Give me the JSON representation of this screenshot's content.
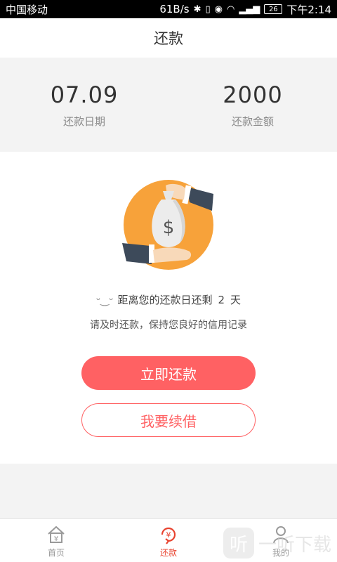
{
  "status_bar": {
    "carrier": "中国移动",
    "speed": "61B/s",
    "battery": "26",
    "time": "下午2:14"
  },
  "header": {
    "title": "还款"
  },
  "summary": {
    "date_value": "07.09",
    "date_label": "还款日期",
    "amount_value": "2000",
    "amount_label": "还款金额"
  },
  "reminder": {
    "prefix": "距离您的还款日还剩",
    "days": "2",
    "suffix": "天",
    "hint": "请及时还款，保持您良好的信用记录"
  },
  "buttons": {
    "repay": "立即还款",
    "renew": "我要续借"
  },
  "bottom_nav": {
    "items": [
      {
        "label": "首页",
        "icon": "home-yen-icon",
        "active": false
      },
      {
        "label": "还款",
        "icon": "repay-yen-icon",
        "active": true
      },
      {
        "label": "我的",
        "icon": "person-icon",
        "active": false
      }
    ]
  },
  "colors": {
    "accent": "#ff6163",
    "active_nav": "#e8432f",
    "illustration_circle": "#f7a23a"
  },
  "watermark": {
    "text": "一听下载",
    "badge": "听"
  }
}
